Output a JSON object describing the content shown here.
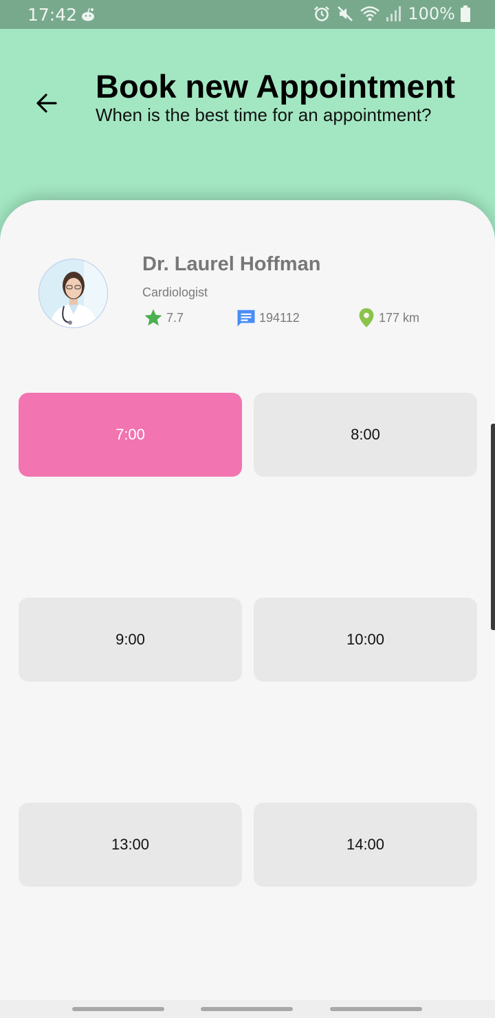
{
  "status_bar": {
    "time": "17:42",
    "battery": "100%",
    "icons": [
      "reddit-icon",
      "alarm-icon",
      "mute-icon",
      "wifi-icon",
      "signal-icon",
      "battery-icon"
    ]
  },
  "header": {
    "back_icon": "arrow-left-icon",
    "title": "Book new Appointment",
    "subtitle": "When is the best time for an appointment?"
  },
  "doctor": {
    "name": "Dr. Laurel Hoffman",
    "specialty": "Cardiologist",
    "rating": "7.7",
    "reviews": "194112",
    "distance": "177 km",
    "stat_icons": [
      "star-icon",
      "message-icon",
      "location-pin-icon"
    ]
  },
  "time_slots": [
    {
      "label": "7:00",
      "selected": true
    },
    {
      "label": "8:00",
      "selected": false
    },
    {
      "label": "9:00",
      "selected": false
    },
    {
      "label": "10:00",
      "selected": false
    },
    {
      "label": "13:00",
      "selected": false
    },
    {
      "label": "14:00",
      "selected": false
    }
  ],
  "colors": {
    "header_bg": "#a3e7c2",
    "status_bg": "#78a98d",
    "selected_slot": "#f274b1",
    "slot_bg": "#e8e8e8",
    "star": "#4caf50",
    "message": "#4a8cf7",
    "pin": "#8bc34a"
  }
}
